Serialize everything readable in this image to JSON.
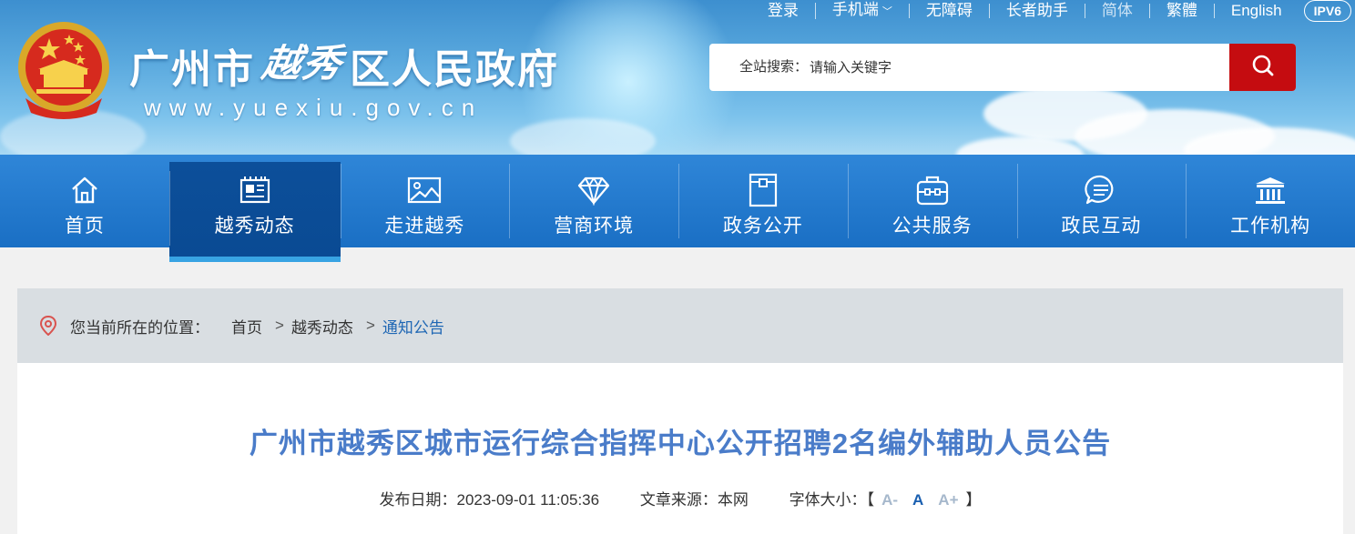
{
  "header": {
    "title_part1": "广州市",
    "title_script": "越秀",
    "title_part2": "区人民政府",
    "url": "www.yuexiu.gov.cn"
  },
  "toplinks": {
    "login": "登录",
    "mobile": "手机端",
    "accessibility": "无障碍",
    "elder": "长者助手",
    "simplified": "简体",
    "traditional": "繁體",
    "english": "English",
    "ipv6": "IPV6"
  },
  "search": {
    "label": "全站搜索：",
    "placeholder": "请输入关键字"
  },
  "nav": {
    "items": [
      {
        "label": "首页",
        "icon": "home-icon"
      },
      {
        "label": "越秀动态",
        "icon": "newspaper-icon"
      },
      {
        "label": "走进越秀",
        "icon": "picture-icon"
      },
      {
        "label": "营商环境",
        "icon": "diamond-icon"
      },
      {
        "label": "政务公开",
        "icon": "folder-icon"
      },
      {
        "label": "公共服务",
        "icon": "briefcase-icon"
      },
      {
        "label": "政民互动",
        "icon": "chat-icon"
      },
      {
        "label": "工作机构",
        "icon": "institution-icon"
      }
    ],
    "active_index": 1
  },
  "breadcrumb": {
    "location_label": "您当前所在的位置：",
    "items": [
      "首页",
      "越秀动态",
      "通知公告"
    ]
  },
  "article": {
    "title": "广州市越秀区城市运行综合指挥中心公开招聘2名编外辅助人员公告",
    "date_label": "发布日期：",
    "date": "2023-09-01 11:05:36",
    "source_label": "文章来源：",
    "source": "本网",
    "fontsize_label": "字体大小：",
    "bracket_open": "【",
    "bracket_close": "】",
    "font_small": "A-",
    "font_normal": "A",
    "font_large": "A+"
  },
  "colors": {
    "nav_bg": "#1a6fc4",
    "nav_active": "#0a4a93",
    "search_button": "#c50c10",
    "title_blue": "#4a7cc9",
    "crumb_current": "#1f67b4"
  }
}
